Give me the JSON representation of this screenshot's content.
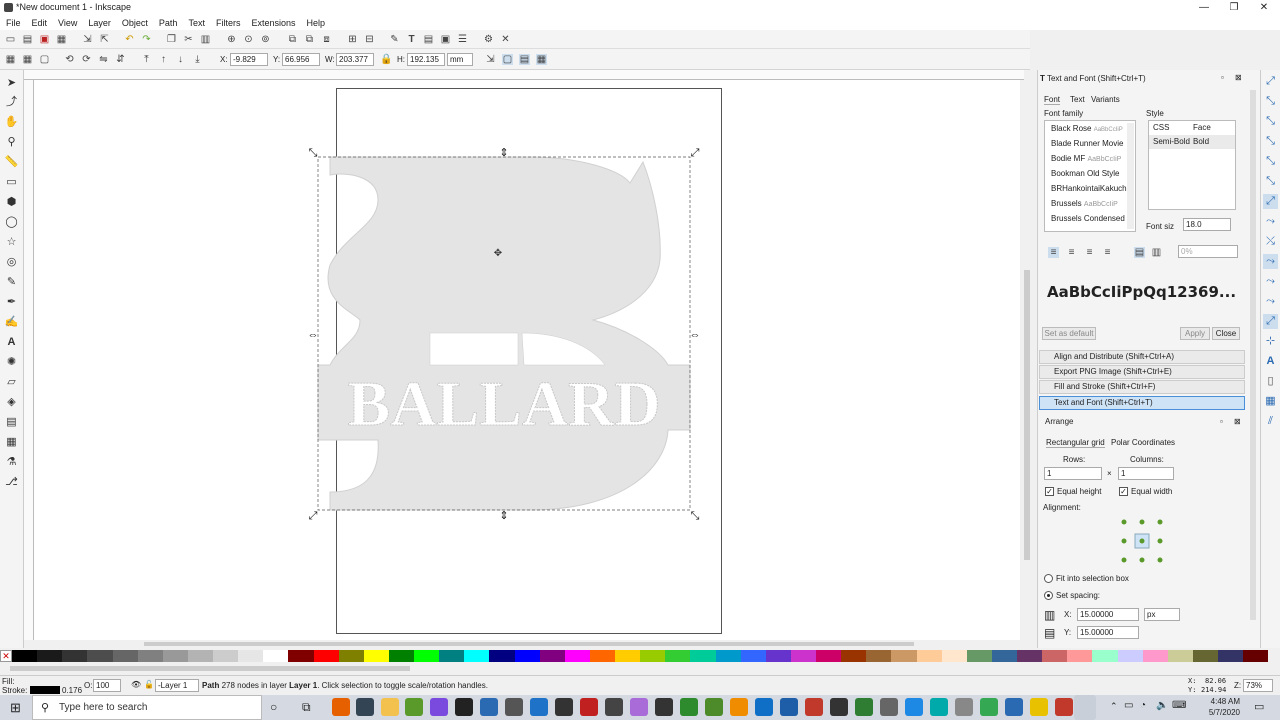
{
  "window": {
    "title": "*New document 1 - Inkscape",
    "minimize": "—",
    "maximize": "❐",
    "close": "✕"
  },
  "menu": [
    "File",
    "Edit",
    "View",
    "Layer",
    "Object",
    "Path",
    "Text",
    "Filters",
    "Extensions",
    "Help"
  ],
  "controls": {
    "x_label": "X:",
    "x_value": "-9.829",
    "y_label": "Y:",
    "y_value": "66.956",
    "w_label": "W:",
    "w_value": "203.377",
    "h_label": "H:",
    "h_value": "192.135",
    "unit": "mm"
  },
  "canvas": {
    "artwork_text": "BALLARD"
  },
  "text_font_panel": {
    "title": "Text and Font (Shift+Ctrl+T)",
    "tabs": [
      "Font",
      "Text",
      "Variants"
    ],
    "font_family_label": "Font family",
    "fonts": [
      "Black Rose",
      "Blade Runner Movie",
      "Bodie MF",
      "Bookman Old Style",
      "BRHankointaiKakuch",
      "Brussels",
      "Brussels Condensed"
    ],
    "font_samples": [
      "AaBbCcIiP",
      "",
      "AaBbCcIiP",
      "",
      "",
      "AaBbCcIiP",
      ""
    ],
    "style_label": "Style",
    "style_headers": [
      "CSS",
      "Face"
    ],
    "style_row": [
      "Semi-Bold",
      "Bold"
    ],
    "font_size_label": "Font siz",
    "font_size_value": "18.0",
    "spacing_value": "0%",
    "preview": "AaBbCcIiPpQq12369...",
    "set_default": "Set as default",
    "apply": "Apply",
    "close": "Close"
  },
  "collapsed_panels": [
    "Align and Distribute (Shift+Ctrl+A)",
    "Export PNG Image (Shift+Ctrl+E)",
    "Fill and Stroke (Shift+Ctrl+F)",
    "Text and Font (Shift+Ctrl+T)"
  ],
  "arrange_panel": {
    "title": "Arrange",
    "tabs": [
      "Rectangular grid",
      "Polar Coordinates"
    ],
    "rows_label": "Rows:",
    "rows_value": "1",
    "cols_label": "Columns:",
    "cols_value": "1",
    "times": "×",
    "equal_height": "Equal height",
    "equal_width": "Equal width",
    "alignment_label": "Alignment:",
    "fit_into": "Fit into selection box",
    "set_spacing": "Set spacing:",
    "x_label": "X:",
    "x_value": "15.00000",
    "y_label": "Y:",
    "y_value": "15.00000",
    "unit": "px"
  },
  "status": {
    "fill_label": "Fill:",
    "stroke_label": "Stroke:",
    "stroke_width": "0.176",
    "opacity_label": "O:",
    "opacity_value": "100",
    "layer": "-Layer 1",
    "message_bold": "Path",
    "message": " 278 nodes in layer ",
    "message_layer": "Layer 1",
    "message_end": ". Click selection to toggle scale/rotation handles.",
    "cursor_x_label": "X:",
    "cursor_x": "82.06",
    "cursor_y_label": "Y:",
    "cursor_y": "214.94",
    "zoom_label": "Z:",
    "zoom_value": "73%"
  },
  "taskbar": {
    "search_placeholder": "Type here to search",
    "time": "4:48 AM",
    "date": "5/7/2020"
  },
  "palette_colors": [
    "#000000",
    "#1a1a1a",
    "#333333",
    "#4d4d4d",
    "#666666",
    "#808080",
    "#999999",
    "#b3b3b3",
    "#cccccc",
    "#e6e6e6",
    "#ffffff",
    "#800000",
    "#ff0000",
    "#808000",
    "#ffff00",
    "#008000",
    "#00ff00",
    "#008080",
    "#00ffff",
    "#000080",
    "#0000ff",
    "#800080",
    "#ff00ff",
    "#ff6600",
    "#ffcc00",
    "#99cc00",
    "#33cc33",
    "#00cc99",
    "#0099cc",
    "#3366ff",
    "#6633cc",
    "#cc33cc",
    "#cc0066",
    "#993300",
    "#996633",
    "#cc9966",
    "#ffcc99",
    "#ffe6cc",
    "#669966",
    "#336699",
    "#663366",
    "#cc6666",
    "#ff9999",
    "#99ffcc",
    "#ccccff",
    "#ff99cc",
    "#cccc99",
    "#666633",
    "#333366",
    "#660000"
  ]
}
